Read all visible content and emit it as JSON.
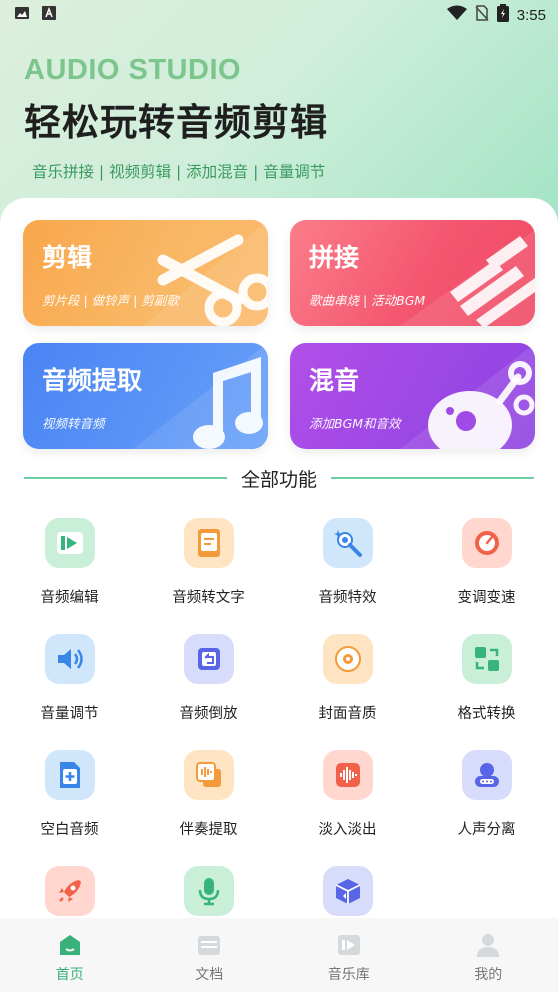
{
  "status_bar": {
    "time": "3:55"
  },
  "hero": {
    "brand": "AUDIO STUDIO",
    "headline": "轻松玩转音频剪辑",
    "tagline": "音乐拼接 | 视频剪辑 | 添加混音 | 音量调节"
  },
  "cards": [
    {
      "title": "剪辑",
      "subtitle": "剪片段 | 做铃声 | 剪副歌",
      "icon": "scissors-icon"
    },
    {
      "title": "拼接",
      "subtitle": "歌曲串烧 | 活动BGM",
      "icon": "stripes-icon"
    },
    {
      "title": "音频提取",
      "subtitle": "视频转音频",
      "icon": "music-note-icon"
    },
    {
      "title": "混音",
      "subtitle": "添加BGM和音效",
      "icon": "mix-icon"
    }
  ],
  "section_title": "全部功能",
  "features": [
    {
      "label": "音频编辑",
      "icon": "play-icon"
    },
    {
      "label": "音频转文字",
      "icon": "document-icon"
    },
    {
      "label": "音频特效",
      "icon": "magic-wand-icon"
    },
    {
      "label": "变调变速",
      "icon": "speedometer-icon"
    },
    {
      "label": "音量调节",
      "icon": "speaker-icon"
    },
    {
      "label": "音频倒放",
      "icon": "reverse-icon"
    },
    {
      "label": "封面音质",
      "icon": "disc-icon"
    },
    {
      "label": "格式转换",
      "icon": "convert-icon"
    },
    {
      "label": "空白音频",
      "icon": "blank-file-icon"
    },
    {
      "label": "伴奏提取",
      "icon": "accompaniment-icon"
    },
    {
      "label": "淡入淡出",
      "icon": "fade-icon"
    },
    {
      "label": "人声分离",
      "icon": "voice-separation-icon"
    },
    {
      "label": "",
      "icon": "rocket-icon"
    },
    {
      "label": "",
      "icon": "microphone-icon"
    },
    {
      "label": "",
      "icon": "box-icon"
    }
  ],
  "tabs": [
    {
      "label": "首页",
      "icon": "home-icon",
      "active": true
    },
    {
      "label": "文档",
      "icon": "folder-icon",
      "active": false
    },
    {
      "label": "音乐库",
      "icon": "music-library-icon",
      "active": false
    },
    {
      "label": "我的",
      "icon": "profile-icon",
      "active": false
    }
  ],
  "colors": {
    "accent": "#38b17a",
    "brand_text": "#7cc58d",
    "card_cut": "#f7a54a",
    "card_join": "#f4566f",
    "card_extract": "#4f8ef5",
    "card_mix": "#a34ee6"
  }
}
